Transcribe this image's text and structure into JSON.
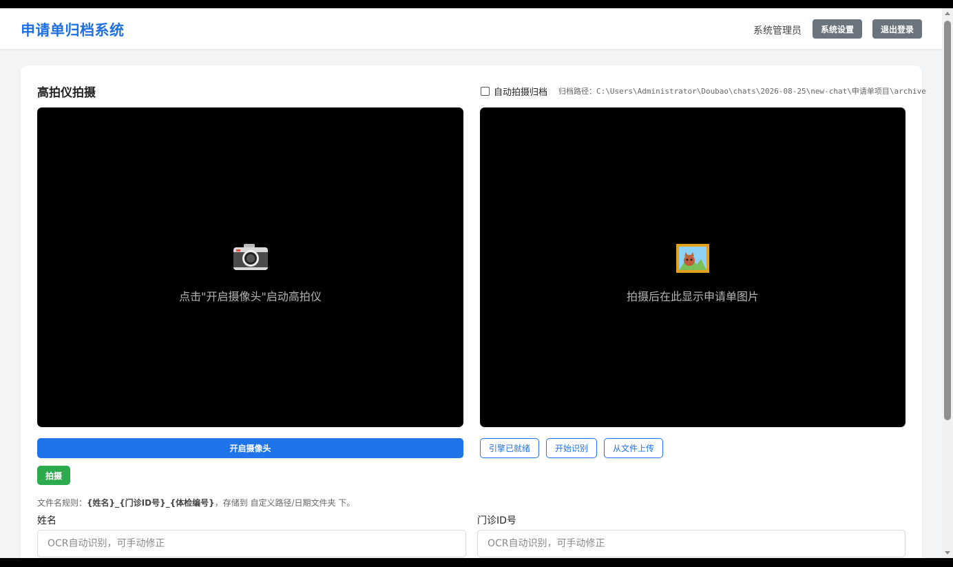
{
  "header": {
    "title": "申请单归档系统",
    "user": "系统管理员",
    "settings_label": "系统设置",
    "logout_label": "退出登录"
  },
  "capture": {
    "title": "高拍仪拍摄",
    "auto_archive_label": "自动拍摄归档",
    "auto_archive_checked": false,
    "archive_path": "归档路径：C:\\Users\\Administrator\\Doubao\\chats\\2026-08-25\\new-chat\\申请单项目\\archive",
    "camera_panel": {
      "icon": "camera-icon",
      "text": "点击\"开启摄像头\"启动高拍仪"
    },
    "preview_panel": {
      "icon": "framed-picture-icon",
      "text": "拍摄后在此显示申请单图片"
    },
    "open_camera_label": "开启摄像头",
    "shoot_label": "拍摄",
    "engine_ready_label": "引擎已就绪",
    "start_recognize_label": "开始识别",
    "upload_label": "从文件上传",
    "rule_prefix": "文件名规则：",
    "rule_pattern": "{姓名}_{门诊ID号}_{体检编号}",
    "rule_suffix": "，存储到 自定义路径/日期文件夹 下。"
  },
  "form": {
    "name_label": "姓名",
    "name_placeholder": "OCR自动识别，可手动修正",
    "id_label": "门诊ID号",
    "id_placeholder": "OCR自动识别，可手动修正"
  },
  "colors": {
    "brand": "#1f6fe0",
    "primary_button": "#1f74ea",
    "success_button": "#2daa4d",
    "header_button": "#6b737c"
  }
}
